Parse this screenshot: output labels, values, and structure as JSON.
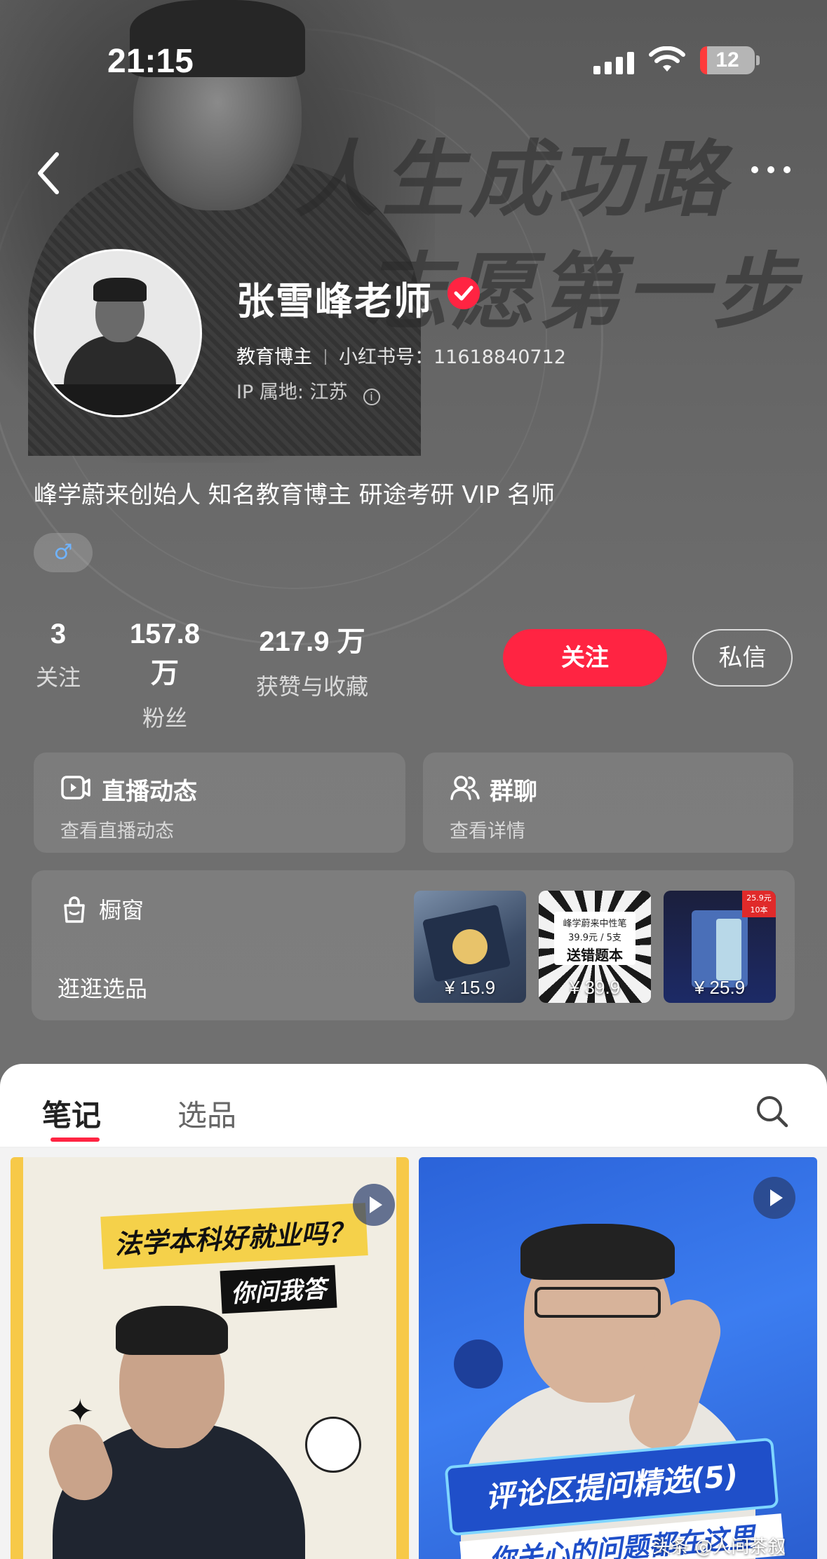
{
  "status_bar": {
    "time": "21:15",
    "battery": "12"
  },
  "banner": {
    "slogan_line1": "人生成功路",
    "slogan_line2": "志愿第一步"
  },
  "profile": {
    "name": "张雪峰老师",
    "tag": "教育博主",
    "xhs_id": "小红书号：11618840712",
    "ip_location": "IP 属地: 江苏",
    "bio": "峰学蔚来创始人 知名教育博主 研途考研 VIP 名师",
    "gender_symbol": "♂"
  },
  "stats": [
    {
      "value": "3",
      "label": "关注"
    },
    {
      "value": "157.8 万",
      "label": "粉丝"
    },
    {
      "value": "217.9 万",
      "label": "获赞与收藏"
    }
  ],
  "actions": {
    "follow": "关注",
    "message": "私信"
  },
  "cards": {
    "live": {
      "title": "直播动态",
      "subtitle": "查看直播动态"
    },
    "group": {
      "title": "群聊",
      "subtitle": "查看详情"
    },
    "shop": {
      "title": "橱窗",
      "subtitle": "逛逛选品"
    }
  },
  "products": [
    {
      "price": "¥ 15.9"
    },
    {
      "price": "¥ 39.9",
      "caption_line1": "峰学蔚来中性笔",
      "caption_line2": "39.9元 / 5支",
      "caption_line3": "送错题本"
    },
    {
      "price": "¥ 25.9",
      "badge": "25.9元 10本"
    }
  ],
  "tabs": {
    "notes": "笔记",
    "picks": "选品"
  },
  "notes": [
    {
      "title": "法学本科好就业吗？",
      "subtitle": "你问我答"
    },
    {
      "title": "评论区提问精选(5)",
      "subtitle": "你关心的问题都在这里"
    }
  ],
  "watermark": "头条 @人间茶叙",
  "colors": {
    "accent": "#ff2442",
    "background": "#6b6b6b"
  }
}
